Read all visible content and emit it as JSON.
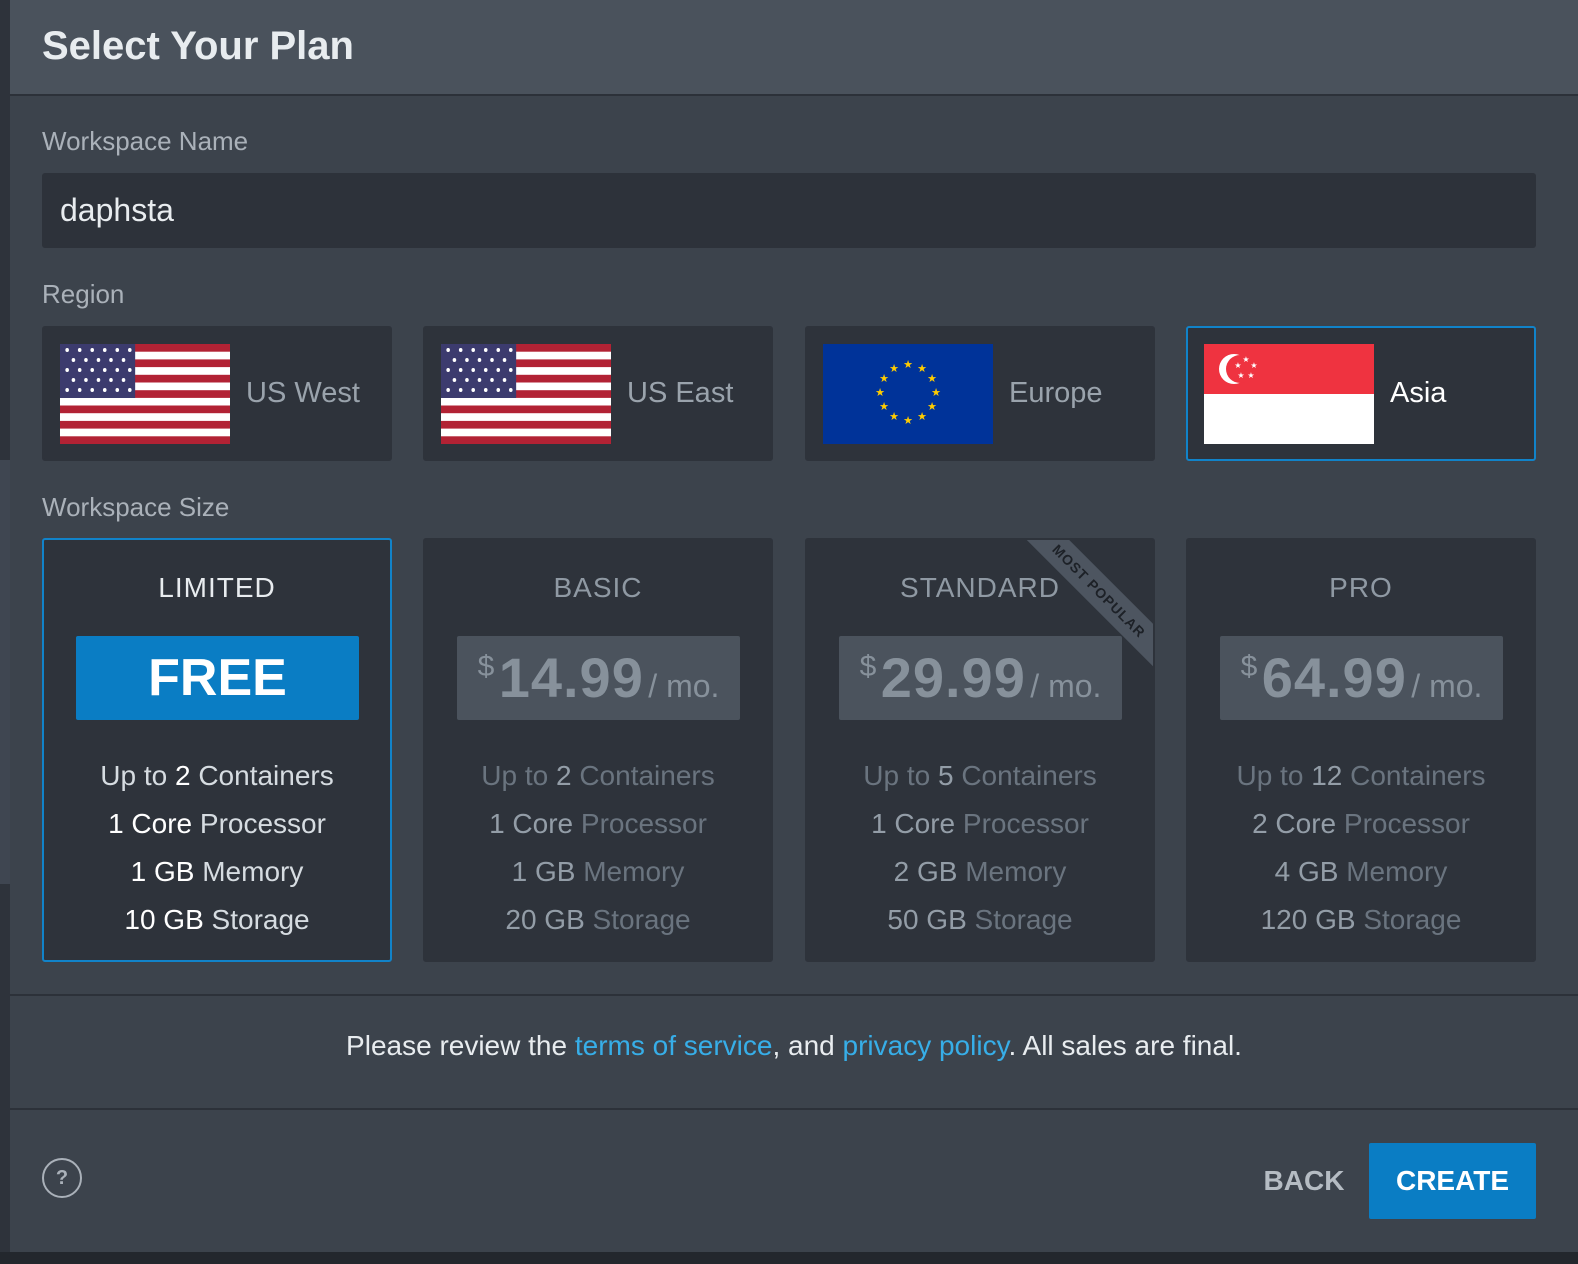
{
  "header": {
    "title": "Select Your Plan"
  },
  "workspace_name": {
    "label": "Workspace Name",
    "value": "daphsta"
  },
  "region": {
    "label": "Region",
    "selected": "Asia",
    "options": [
      {
        "name": "US West",
        "flag": "us-flag-icon"
      },
      {
        "name": "US East",
        "flag": "us-flag-icon"
      },
      {
        "name": "Europe",
        "flag": "eu-flag-icon"
      },
      {
        "name": "Asia",
        "flag": "singapore-flag-icon"
      }
    ]
  },
  "workspace_size": {
    "label": "Workspace Size",
    "selected": "LIMITED",
    "plans": [
      {
        "name": "LIMITED",
        "price": "FREE",
        "containers": "2",
        "cores": "1 Core",
        "memory": "1 GB",
        "storage": "10 GB"
      },
      {
        "name": "BASIC",
        "currency": "$",
        "price": "14.99",
        "period": "/ mo.",
        "containers": "2",
        "cores": "1 Core",
        "memory": "1 GB",
        "storage": "20 GB"
      },
      {
        "name": "STANDARD",
        "currency": "$",
        "price": "29.99",
        "period": "/ mo.",
        "containers": "5",
        "cores": "1 Core",
        "memory": "2 GB",
        "storage": "50 GB",
        "ribbon": "MOST POPULAR"
      },
      {
        "name": "PRO",
        "currency": "$",
        "price": "64.99",
        "period": "/ mo.",
        "containers": "12",
        "cores": "2 Core",
        "memory": "4 GB",
        "storage": "120 GB"
      }
    ],
    "feature_words": {
      "up_to": "Up to",
      "containers": "Containers",
      "processor": "Processor",
      "memory": "Memory",
      "storage": "Storage"
    }
  },
  "terms": {
    "prefix": "Please review the ",
    "tos_link": "terms of service",
    "middle": ", and ",
    "privacy_link": "privacy policy",
    "suffix": ". All sales are final."
  },
  "footer": {
    "help": "?",
    "back": "BACK",
    "create": "CREATE"
  },
  "colors": {
    "accent": "#0a7dc4",
    "link": "#37aee8",
    "background": "#3c434c",
    "card": "#2e333b"
  }
}
